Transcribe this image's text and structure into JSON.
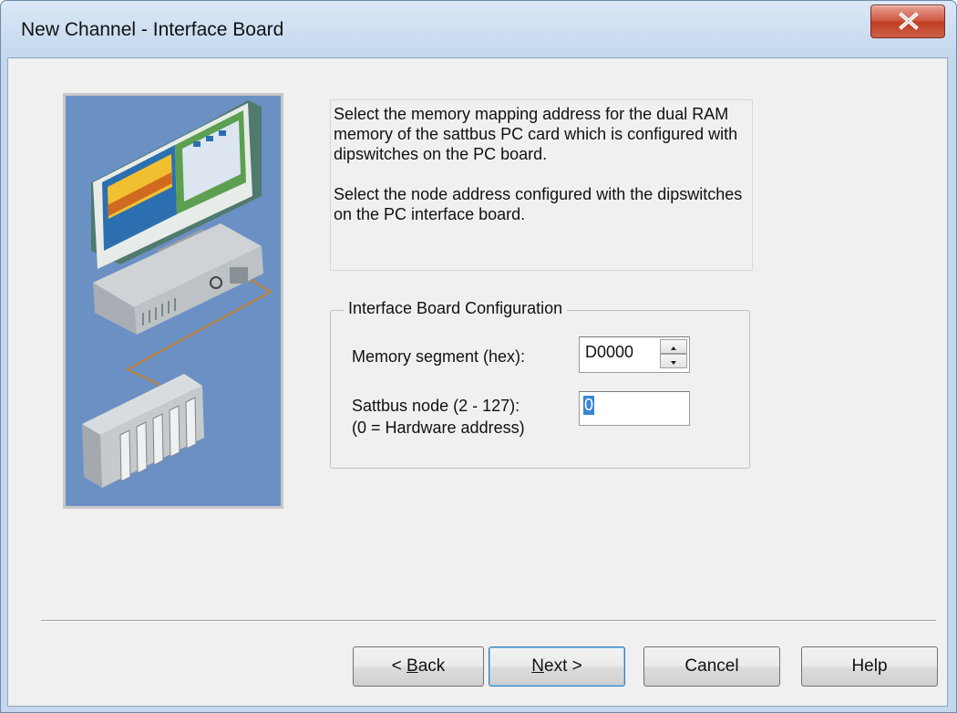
{
  "window": {
    "title": "New Channel - Interface Board"
  },
  "description": {
    "paragraph1": "Select the memory mapping address for the dual RAM memory of the sattbus PC card which is configured with dipswitches on the PC board.",
    "paragraph2": "Select the node address configured with the dipswitches on the PC interface board."
  },
  "group": {
    "title": "Interface Board Configuration",
    "memory_label": "Memory segment (hex):",
    "memory_value": "D0000",
    "node_label_line1": "Sattbus node (2 - 127):",
    "node_label_line2": "(0 = Hardware address)",
    "node_value": "0"
  },
  "buttons": {
    "back_prefix": "< ",
    "back_accel": "B",
    "back_rest": "ack",
    "next_accel": "N",
    "next_rest": "ext >",
    "cancel": "Cancel",
    "help": "Help"
  },
  "icons": [
    "close-icon",
    "spin-up-icon",
    "spin-down-icon",
    "pc-network-illustration"
  ]
}
